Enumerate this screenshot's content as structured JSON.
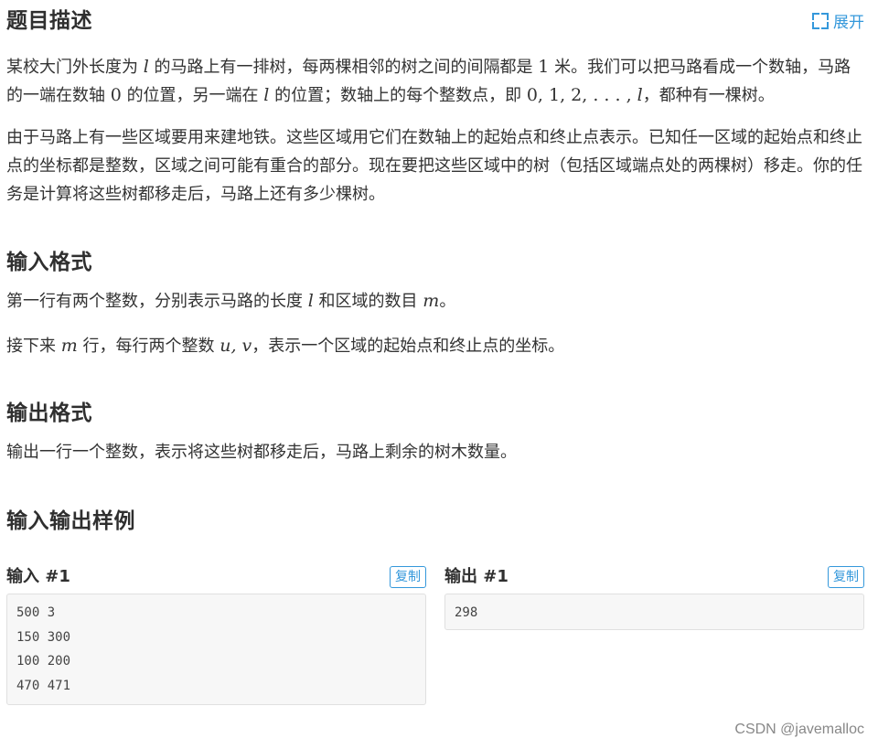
{
  "expand_label": "展开",
  "description": {
    "title": "题目描述",
    "p1": {
      "a": "某校大门外长度为",
      "l": "l",
      "b": "的马路上有一排树，每两棵相邻的树之间的间隔都是",
      "one": "1",
      "c": "米。我们可以把马路看成一个数轴，马路的一端在数轴",
      "zero": "0",
      "d": "的位置，另一端在",
      "l2": "l",
      "e": "的位置；数轴上的每个整数点，即",
      "seq": "0, 1, 2, . . . , ",
      "seq_l": "l",
      "f": "，都种有一棵树。"
    },
    "p2": "由于马路上有一些区域要用来建地铁。这些区域用它们在数轴上的起始点和终止点表示。已知任一区域的起始点和终止点的坐标都是整数，区域之间可能有重合的部分。现在要把这些区域中的树（包括区域端点处的两棵树）移走。你的任务是计算将这些树都移走后，马路上还有多少棵树。"
  },
  "input_format": {
    "title": "输入格式",
    "line1": {
      "a": "第一行有两个整数，分别表示马路的长度",
      "l": "l",
      "b": "和区域的数目",
      "m": "m",
      "c": "。"
    },
    "line2": {
      "a": "接下来",
      "m": "m",
      "b": "行，每行两个整数",
      "uv": "u, v",
      "c": "，表示一个区域的起始点和终止点的坐标。"
    }
  },
  "output_format": {
    "title": "输出格式",
    "text": "输出一行一个整数，表示将这些树都移走后，马路上剩余的树木数量。"
  },
  "samples": {
    "title": "输入输出样例",
    "copy_label": "复制",
    "input": {
      "title": "输入 #1",
      "lines": [
        "500 3",
        "150 300",
        "100 200",
        "470 471"
      ]
    },
    "output": {
      "title": "输出 #1",
      "lines": [
        "298"
      ]
    }
  },
  "watermark": "CSDN @javemalloc",
  "colors": {
    "accent": "#3498db",
    "code_bg": "#f7f7f7"
  }
}
